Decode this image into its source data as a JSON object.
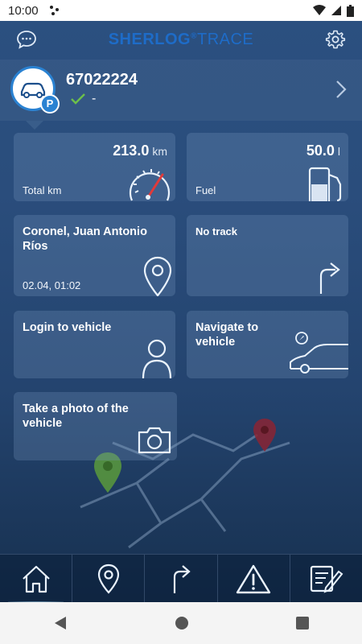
{
  "status_bar": {
    "time": "10:00"
  },
  "header": {
    "logo_bold": "SHERLOG",
    "logo_thin": "TRACE",
    "chat_icon": "chat-bubble-icon",
    "settings_icon": "gear-icon"
  },
  "vehicle": {
    "plate": "67022224",
    "status_text": "-",
    "status_icon": "check-icon",
    "avatar_icon": "car-icon",
    "badge": "P"
  },
  "tiles": {
    "total_km": {
      "value": "213.0",
      "unit": "km",
      "label": "Total km"
    },
    "fuel": {
      "value": "50.0",
      "unit": "l",
      "label": "Fuel"
    },
    "location": {
      "title": "Coronel, Juan Antonio Ríos",
      "datetime": "02.04, 01:02"
    },
    "track": {
      "title": "No track"
    },
    "login": {
      "title": "Login to vehicle"
    },
    "navigate": {
      "title": "Navigate to vehicle"
    },
    "photo": {
      "title": "Take a photo of the vehicle"
    }
  },
  "bottom_nav": [
    "home-icon",
    "location-pin-icon",
    "turn-right-arrow-icon",
    "warning-icon",
    "notes-edit-icon"
  ],
  "colors": {
    "accent": "#2a82d2",
    "logo": "#1e6cc8",
    "check": "#6cc04a",
    "gauge_needle": "#e03a3a"
  }
}
